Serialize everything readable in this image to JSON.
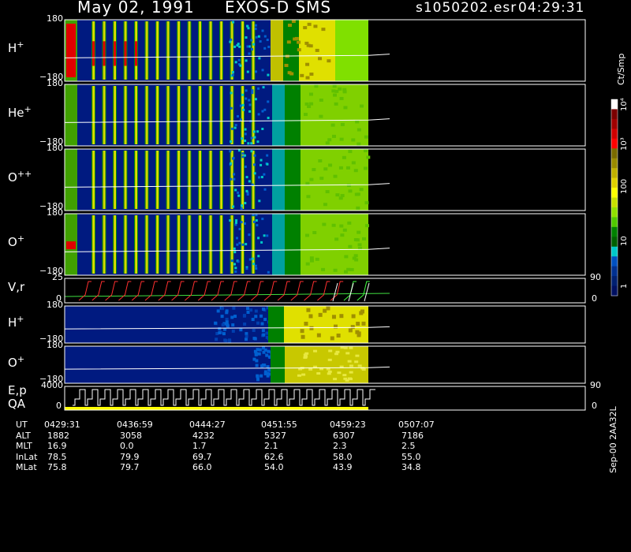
{
  "header": {
    "date": "May 02, 1991",
    "instrument": "EXOS-D SMS",
    "filename": "s1050202.esr",
    "time": "04:29:31"
  },
  "colorbar": {
    "unit": "Ct/Smp",
    "ticks": [
      "10⁴",
      "10³",
      "100",
      "10",
      "1"
    ],
    "colors": [
      "#ffffff",
      "#7a0000",
      "#a00000",
      "#d00000",
      "#ff0000",
      "#7a6a00",
      "#9a8a00",
      "#c0b000",
      "#e0d000",
      "#ffff00",
      "#c8e000",
      "#90e000",
      "#50c800",
      "#008000",
      "#006000",
      "#00c8c8",
      "#0050c0",
      "#003090",
      "#002070",
      "#001060"
    ]
  },
  "panels": [
    {
      "label": "H",
      "sup": "+",
      "ymax": "180",
      "ymin": "−180"
    },
    {
      "label": "He",
      "sup": "+",
      "ymax": "180",
      "ymin": "−180"
    },
    {
      "label": "O",
      "sup": "++",
      "ymax": "180",
      "ymin": "−180"
    },
    {
      "label": "O",
      "sup": "+",
      "ymax": "180",
      "ymin": "−180"
    },
    {
      "label": "V,r",
      "sup": "",
      "ymax": "25",
      "ymin": "0",
      "rmax": "90",
      "rmin": "0"
    },
    {
      "label": "H",
      "sup": "+",
      "ymax": "180",
      "ymin": "−180"
    },
    {
      "label": "O",
      "sup": "+",
      "ymax": "180",
      "ymin": "−180"
    },
    {
      "label": "E,p",
      "sup": "",
      "label2": "QA",
      "ymax": "4000",
      "ymin": "0",
      "rmax": "90",
      "rmin": "0"
    }
  ],
  "footer": {
    "side_label": "Sep-00 2AA32L",
    "rows": [
      {
        "name": "UT",
        "values": [
          "0429:31",
          "0436:59",
          "0444:27",
          "0451:55",
          "0459:23",
          "0507:07"
        ]
      },
      {
        "name": "ALT",
        "values": [
          "1882",
          "3058",
          "4232",
          "5327",
          "6307",
          "7186"
        ]
      },
      {
        "name": "MLT",
        "values": [
          "16.9",
          "0.0",
          "1.7",
          "2.1",
          "2.3",
          "2.5"
        ]
      },
      {
        "name": "InLat",
        "values": [
          "78.5",
          "79.9",
          "69.7",
          "62.6",
          "58.0",
          "55.0"
        ]
      },
      {
        "name": "MLat",
        "values": [
          "75.8",
          "79.7",
          "66.0",
          "54.0",
          "43.9",
          "34.8"
        ]
      }
    ]
  },
  "chart_data": {
    "type": "heatmap",
    "title": "May 02, 1991   EXOS-D SMS",
    "x_ticks_ut": [
      "0429:31",
      "0436:59",
      "0444:27",
      "0451:55",
      "0459:23",
      "0507:07"
    ],
    "color_scale": {
      "unit": "Ct/Smp",
      "log": true,
      "range": [
        1,
        10000
      ]
    },
    "series": [
      {
        "name": "H+",
        "ylim": [
          -180,
          180
        ]
      },
      {
        "name": "He+",
        "ylim": [
          -180,
          180
        ]
      },
      {
        "name": "O++",
        "ylim": [
          -180,
          180
        ]
      },
      {
        "name": "O+",
        "ylim": [
          -180,
          180
        ]
      },
      {
        "name": "V,r",
        "ylim": [
          0,
          25
        ],
        "right_ylim": [
          0,
          90
        ]
      },
      {
        "name": "H+",
        "ylim": [
          -180,
          180
        ]
      },
      {
        "name": "O+",
        "ylim": [
          -180,
          180
        ]
      },
      {
        "name": "E,p",
        "ylim": [
          0,
          4000
        ],
        "right_ylim": [
          0,
          90
        ]
      }
    ]
  }
}
